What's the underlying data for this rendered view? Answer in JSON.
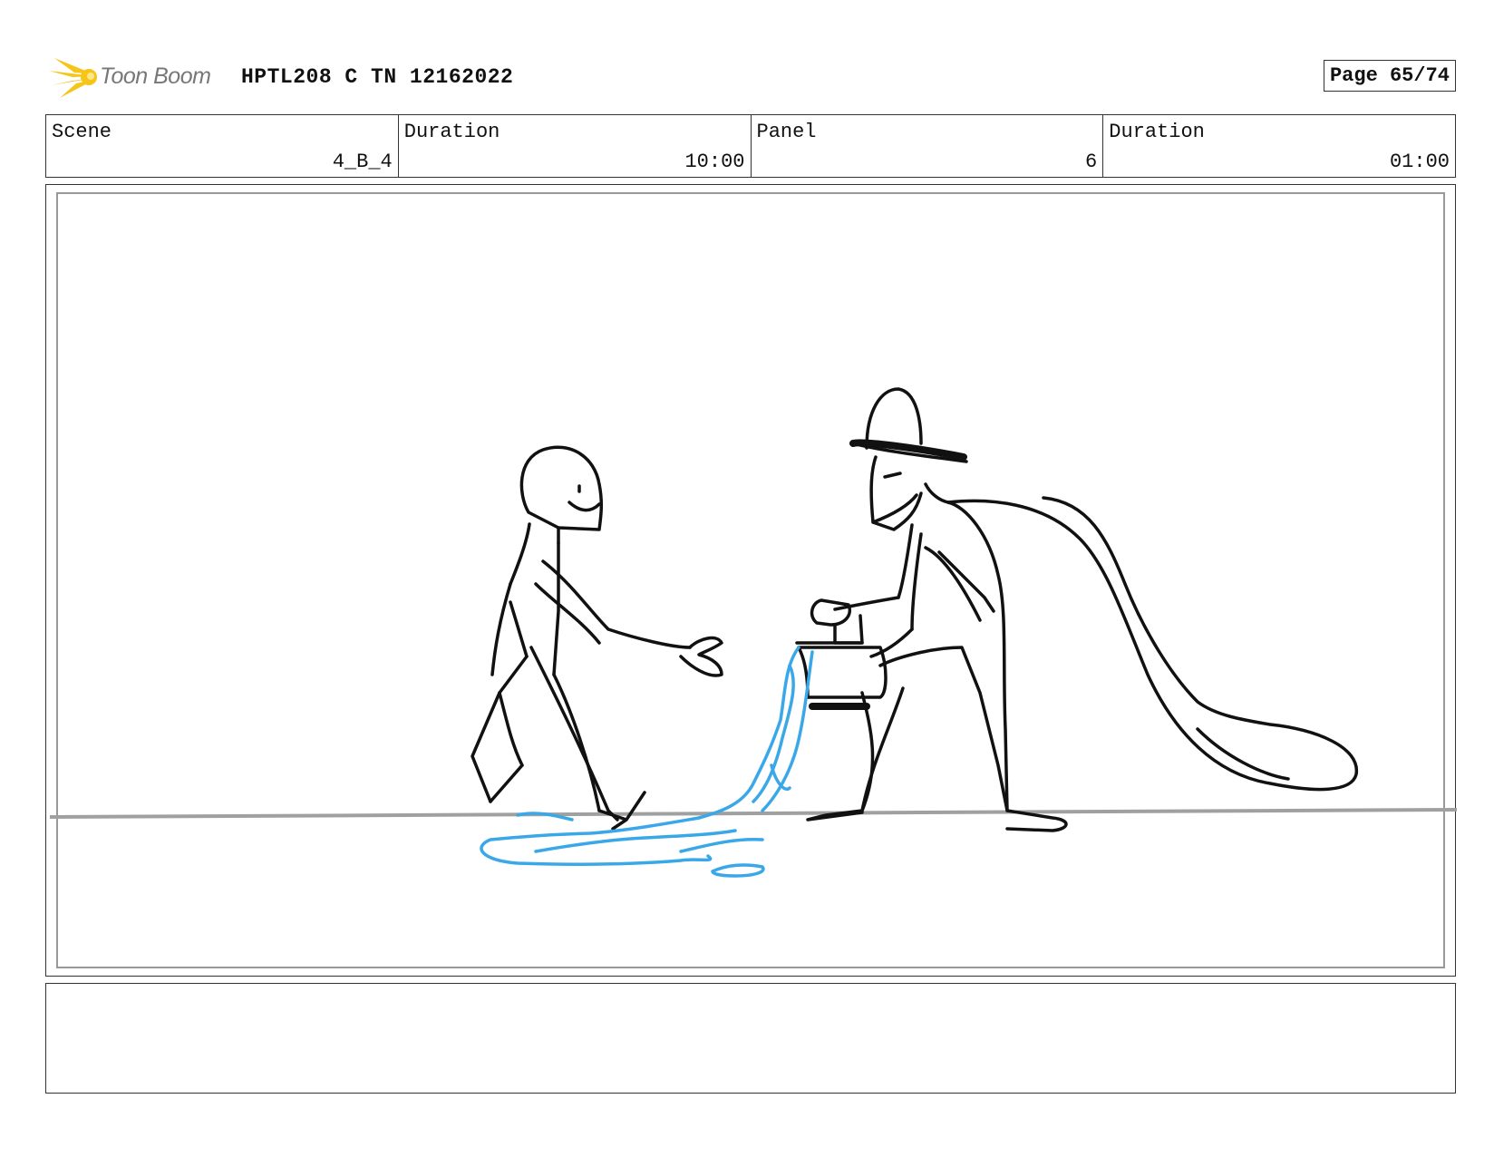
{
  "header": {
    "logo_text": "Toon Boom",
    "title": "HPTL208 C TN 12162022",
    "page_label": "Page 65/74"
  },
  "info": [
    {
      "label": "Scene",
      "value": "4_B_4"
    },
    {
      "label": "Duration",
      "value": "10:00"
    },
    {
      "label": "Panel",
      "value": "6"
    },
    {
      "label": "Duration",
      "value": "01:00"
    }
  ],
  "colors": {
    "logo_star": "#f5c518",
    "ink": "#111111",
    "water": "#3aa8e8",
    "horizon": "#a0a0a0"
  },
  "notes": ""
}
